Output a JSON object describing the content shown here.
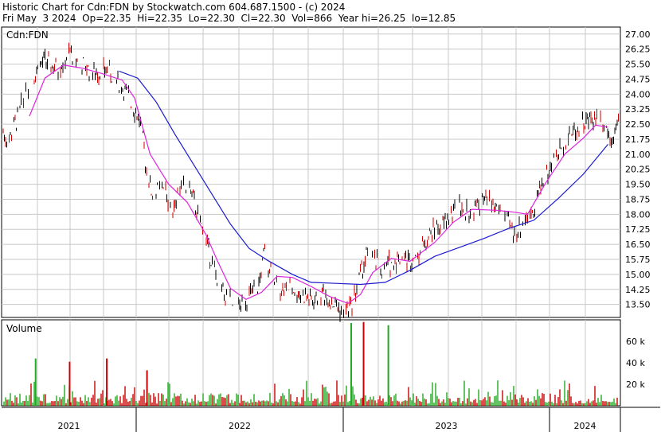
{
  "header": {
    "line1": "Historic Chart for Cdn:FDN by Stockwatch.com 604.687.1500 - (c) 2024",
    "line2": "Fri May  3 2024  Op=22.35  Hi=22.35  Lo=22.30  Cl=22.30  Vol=866  Year hi=26.25  lo=12.85"
  },
  "chart_data": [
    {
      "type": "line",
      "symbol_label": "Cdn:FDN",
      "ylim": [
        12.85,
        27.35
      ],
      "yticks": [
        "27.00",
        "26.25",
        "25.50",
        "24.75",
        "24.00",
        "23.25",
        "22.50",
        "21.75",
        "21.00",
        "20.25",
        "19.50",
        "18.75",
        "18.00",
        "17.25",
        "16.50",
        "15.75",
        "15.00",
        "14.25",
        "13.50"
      ],
      "xlabels": [
        "2021",
        "2022",
        "2023",
        "2024"
      ],
      "grid": true,
      "colors": {
        "price_up": "#000000",
        "price_down": "#cc0000",
        "ma_short": "#dd22dd",
        "ma_long": "#1a1ad0",
        "grid": "#c8c8c8"
      },
      "series": [
        {
          "key": "ma_short",
          "values": [
            [
              0.045,
              22.9
            ],
            [
              0.07,
              24.8
            ],
            [
              0.1,
              25.45
            ],
            [
              0.13,
              25.3
            ],
            [
              0.16,
              25.05
            ],
            [
              0.195,
              24.7
            ],
            [
              0.215,
              23.8
            ],
            [
              0.24,
              21.0
            ],
            [
              0.27,
              19.5
            ],
            [
              0.3,
              18.6
            ],
            [
              0.33,
              17.0
            ],
            [
              0.35,
              15.6
            ],
            [
              0.37,
              14.3
            ],
            [
              0.395,
              13.75
            ],
            [
              0.42,
              14.1
            ],
            [
              0.445,
              14.9
            ],
            [
              0.47,
              14.85
            ],
            [
              0.5,
              14.4
            ],
            [
              0.53,
              13.9
            ],
            [
              0.56,
              13.55
            ],
            [
              0.58,
              14.0
            ],
            [
              0.6,
              15.1
            ],
            [
              0.63,
              15.8
            ],
            [
              0.66,
              15.65
            ],
            [
              0.7,
              16.6
            ],
            [
              0.73,
              17.6
            ],
            [
              0.76,
              18.25
            ],
            [
              0.8,
              18.2
            ],
            [
              0.83,
              18.1
            ],
            [
              0.85,
              18.0
            ],
            [
              0.88,
              19.6
            ],
            [
              0.91,
              21.0
            ],
            [
              0.94,
              21.8
            ],
            [
              0.96,
              22.45
            ],
            [
              0.98,
              22.35
            ]
          ]
        },
        {
          "key": "ma_long",
          "values": [
            [
              0.19,
              25.15
            ],
            [
              0.22,
              24.8
            ],
            [
              0.25,
              23.6
            ],
            [
              0.28,
              22.0
            ],
            [
              0.31,
              20.5
            ],
            [
              0.34,
              19.0
            ],
            [
              0.37,
              17.5
            ],
            [
              0.4,
              16.3
            ],
            [
              0.43,
              15.7
            ],
            [
              0.47,
              15.0
            ],
            [
              0.5,
              14.6
            ],
            [
              0.54,
              14.55
            ],
            [
              0.58,
              14.5
            ],
            [
              0.62,
              14.6
            ],
            [
              0.66,
              15.2
            ],
            [
              0.7,
              15.9
            ],
            [
              0.74,
              16.35
            ],
            [
              0.78,
              16.8
            ],
            [
              0.82,
              17.3
            ],
            [
              0.86,
              17.7
            ],
            [
              0.9,
              18.8
            ],
            [
              0.94,
              20.0
            ],
            [
              0.98,
              21.5
            ]
          ]
        }
      ]
    },
    {
      "type": "bar",
      "title": "Volume",
      "yticks": [
        "60 k",
        "40 k",
        "20 k"
      ],
      "ylim": [
        0,
        80
      ],
      "unit": "k",
      "notable_spikes": [
        {
          "pos": 0.565,
          "value": 77,
          "color": "green"
        },
        {
          "pos": 0.585,
          "value": 78,
          "color": "red"
        },
        {
          "pos": 0.625,
          "value": 75,
          "color": "green"
        },
        {
          "pos": 0.055,
          "value": 44,
          "color": "green"
        },
        {
          "pos": 0.11,
          "value": 41,
          "color": "red"
        },
        {
          "pos": 0.17,
          "value": 44,
          "color": "red"
        },
        {
          "pos": 0.235,
          "value": 33,
          "color": "red"
        }
      ]
    }
  ]
}
